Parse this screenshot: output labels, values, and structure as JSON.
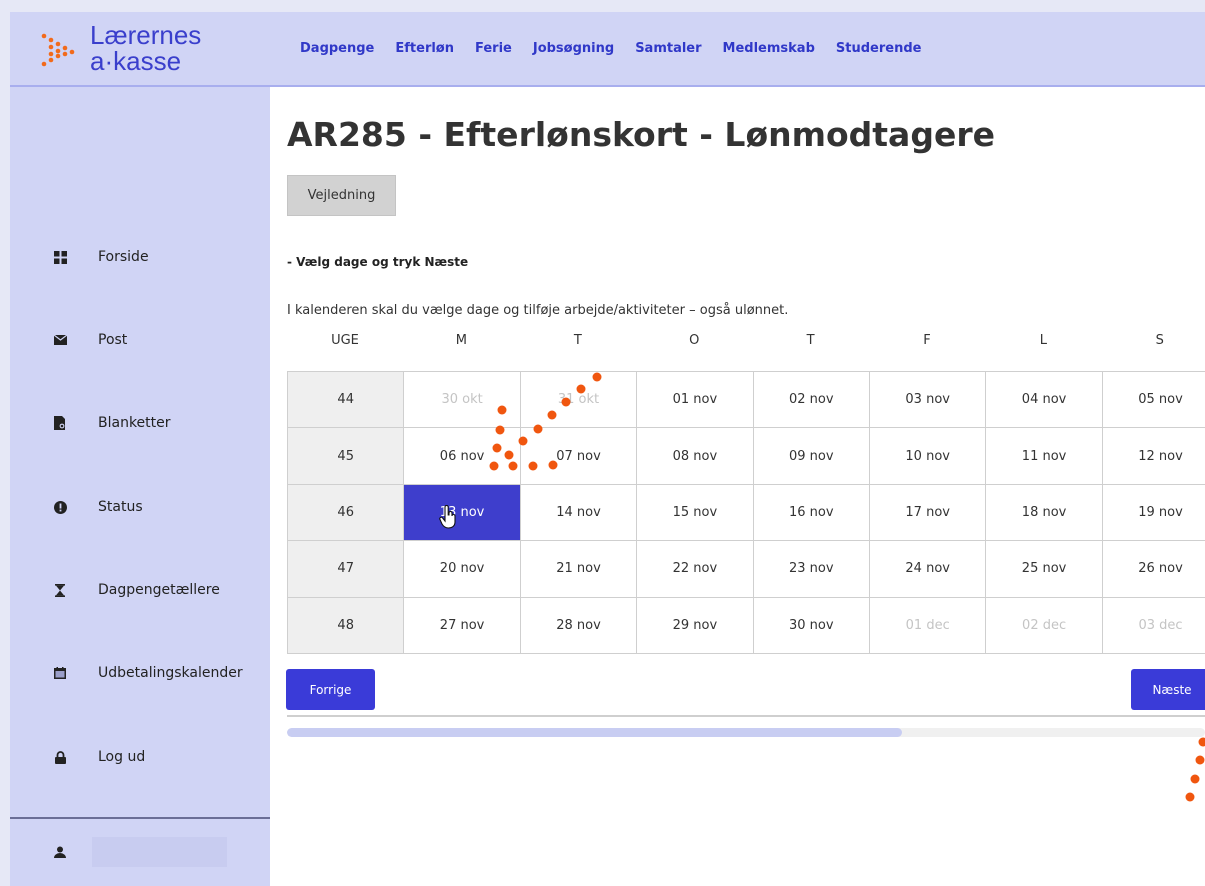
{
  "brand": {
    "logo_line1": "Lærernes",
    "logo_line2": "a·kasse",
    "accent_color": "#3a3bd8",
    "logo_dot_color": "#f26a1b"
  },
  "topnav": {
    "items": [
      "Dagpenge",
      "Efterløn",
      "Ferie",
      "Jobsøgning",
      "Samtaler",
      "Medlemskab",
      "Studerende"
    ]
  },
  "sidebar": {
    "items": [
      {
        "label": "Forside",
        "icon": "grid-icon"
      },
      {
        "label": "Post",
        "icon": "envelope-icon"
      },
      {
        "label": "Blanketter",
        "icon": "document-search-icon"
      },
      {
        "label": "Status",
        "icon": "alert-circle-icon"
      },
      {
        "label": "Dagpengetællere",
        "icon": "hourglass-icon"
      },
      {
        "label": "Udbetalingskalender",
        "icon": "calendar-icon"
      },
      {
        "label": "Log ud",
        "icon": "lock-icon"
      }
    ],
    "user_icon": "user-icon"
  },
  "main": {
    "title": "AR285 - Efterlønskort - Lønmodtagere",
    "guide_button": "Vejledning",
    "instruction": "- Vælg dage og tryk Næste",
    "description": "I kalenderen skal du vælge dage og tilføje arbejde/aktiviteter – også ulønnet.",
    "prev_button": "Forrige",
    "next_button": "Næste",
    "progress_fraction": 0.67
  },
  "calendar": {
    "headers": [
      "UGE",
      "M",
      "T",
      "O",
      "T",
      "F",
      "L",
      "S"
    ],
    "rows": [
      {
        "week": "44",
        "days": [
          {
            "label": "30 okt",
            "muted": true
          },
          {
            "label": "31 okt",
            "muted": true
          },
          {
            "label": "01 nov"
          },
          {
            "label": "02 nov"
          },
          {
            "label": "03 nov"
          },
          {
            "label": "04 nov"
          },
          {
            "label": "05 nov"
          }
        ]
      },
      {
        "week": "45",
        "days": [
          {
            "label": "06 nov"
          },
          {
            "label": "07 nov"
          },
          {
            "label": "08 nov"
          },
          {
            "label": "09 nov"
          },
          {
            "label": "10 nov"
          },
          {
            "label": "11 nov"
          },
          {
            "label": "12 nov"
          }
        ]
      },
      {
        "week": "46",
        "days": [
          {
            "label": "13 nov",
            "selected": true
          },
          {
            "label": "14 nov"
          },
          {
            "label": "15 nov"
          },
          {
            "label": "16 nov"
          },
          {
            "label": "17 nov"
          },
          {
            "label": "18 nov"
          },
          {
            "label": "19 nov"
          }
        ]
      },
      {
        "week": "47",
        "days": [
          {
            "label": "20 nov"
          },
          {
            "label": "21 nov"
          },
          {
            "label": "22 nov"
          },
          {
            "label": "23 nov"
          },
          {
            "label": "24 nov"
          },
          {
            "label": "25 nov"
          },
          {
            "label": "26 nov"
          }
        ]
      },
      {
        "week": "48",
        "days": [
          {
            "label": "27 nov"
          },
          {
            "label": "28 nov"
          },
          {
            "label": "29 nov"
          },
          {
            "label": "30 nov"
          },
          {
            "label": "01 dec",
            "muted": true
          },
          {
            "label": "02 dec",
            "muted": true
          },
          {
            "label": "03 dec",
            "muted": true
          }
        ]
      }
    ]
  }
}
